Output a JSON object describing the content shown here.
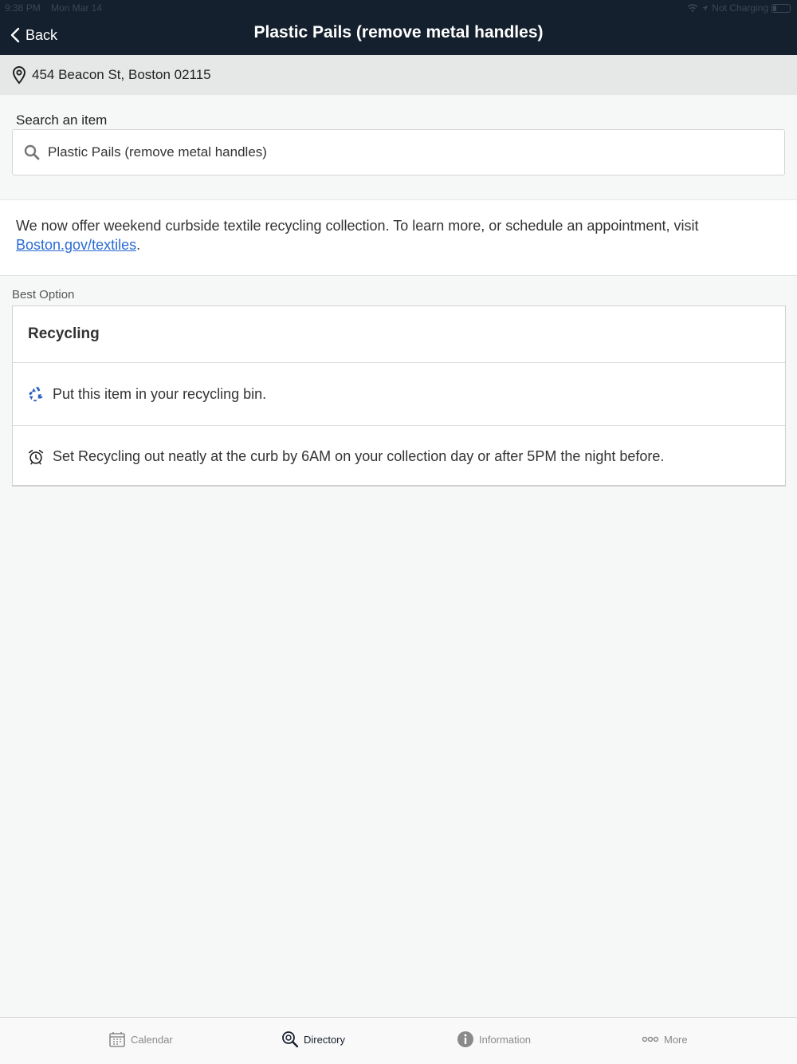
{
  "status_bar": {
    "time": "9:38 PM",
    "date": "Mon Mar 14",
    "charging": "Not Charging"
  },
  "nav": {
    "back_label": "Back",
    "title": "Plastic Pails (remove metal handles)"
  },
  "address": {
    "icon": "location-pin-icon",
    "text": "454 Beacon St, Boston 02115"
  },
  "search": {
    "label": "Search an item",
    "value": "Plastic Pails (remove metal handles)",
    "icon": "search-icon"
  },
  "banner": {
    "text": "We now offer weekend curbside textile recycling collection. To learn more, or schedule an appointment, visit ",
    "link_text": "Boston.gov/textiles",
    "suffix": "."
  },
  "best_option": {
    "label": "Best Option",
    "title": "Recycling",
    "rows": [
      {
        "icon": "recycle-icon",
        "text": "Put this item in your recycling bin."
      },
      {
        "icon": "alarm-clock-icon",
        "text": "Set Recycling out neatly at the curb by 6AM on your collection day or after 5PM the night before."
      }
    ]
  },
  "tabs": [
    {
      "label": "Calendar",
      "icon": "calendar-icon",
      "active": false
    },
    {
      "label": "Directory",
      "icon": "directory-search-icon",
      "active": true
    },
    {
      "label": "Information",
      "icon": "info-icon",
      "active": false
    },
    {
      "label": "More",
      "icon": "more-dots-icon",
      "active": false
    }
  ],
  "colors": {
    "nav_bg": "#15202e",
    "link": "#2a6bd4",
    "recycle_icon": "#2a5fc4"
  }
}
